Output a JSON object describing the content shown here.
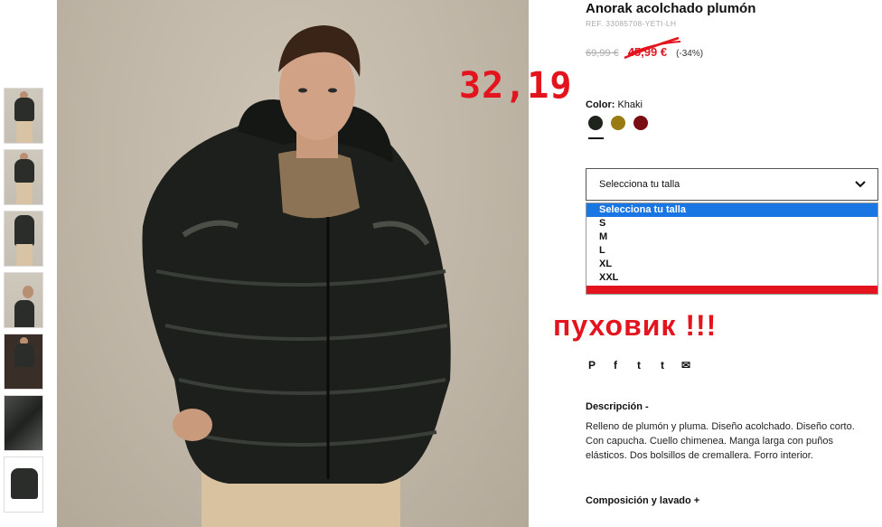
{
  "product": {
    "title": "Anorak acolchado plumón",
    "ref": "REF. 33085708-YETI-LH",
    "old_price": "69,99 €",
    "sale_price": "45,99 €",
    "discount": "(-34%)",
    "handwritten_price": "32,19",
    "color_label": "Color:",
    "color_value": "Khaki",
    "swatches": [
      {
        "name": "dark",
        "color": "#1e231c"
      },
      {
        "name": "khaki",
        "color": "#9a7a12"
      },
      {
        "name": "burgundy",
        "color": "#7a0d12"
      }
    ]
  },
  "size_select": {
    "placeholder": "Selecciona tu talla",
    "options": [
      "Selecciona tu talla",
      "S",
      "M",
      "L",
      "XL",
      "XXL"
    ],
    "selected_index": 0
  },
  "annotation": "пуховик !!!",
  "share_icons": [
    "pinterest-icon",
    "facebook-icon",
    "twitter-icon",
    "tumblr-icon",
    "mail-icon"
  ],
  "share_glyphs": [
    "P",
    "f",
    "t",
    "t",
    "✉"
  ],
  "description": {
    "heading": "Descripción -",
    "text": "Relleno de plumón y pluma. Diseño acolchado. Diseño corto. Con capucha. Cuello chimenea. Manga larga con puños elásticos. Dos bolsillos de cremallera. Forro interior."
  },
  "composition_heading": "Composición y lavado +",
  "colors": {
    "accent": "#e3141e",
    "select_highlight": "#1a76e3"
  }
}
